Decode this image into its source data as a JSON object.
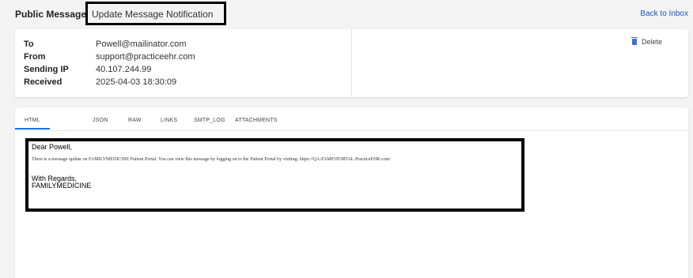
{
  "header": {
    "breadcrumb_root": "Public Message",
    "breadcrumb_separator": "›",
    "subject": "Update Message Notification",
    "back_label": "Back to Inbox"
  },
  "meta": {
    "fields": [
      {
        "label": "To",
        "value": "Powell@mailinator.com"
      },
      {
        "label": "From",
        "value": "support@practiceehr.com"
      },
      {
        "label": "Sending IP",
        "value": "40.107.244.99"
      },
      {
        "label": "Received",
        "value": "2025-04-03 18:30:09"
      }
    ],
    "delete_label": "Delete"
  },
  "tabs": [
    "HTML",
    "JSON",
    "RAW",
    "LINKS",
    "SMTP_LOG",
    "ATTACHMENTS"
  ],
  "active_tab": "HTML",
  "message": {
    "greeting": "Dear Powell,",
    "body": "There is a message update on FAMILYMEDICINE Patient Portal. You can view this message by logging on to the Patient Portal by visiting: https://QA-FAMP1PORTAL.PracticeEHR.com/",
    "closing": "With Regards,",
    "signature": "FAMILYMEDICINE"
  },
  "colors": {
    "link": "#1a56c4",
    "tab_active_underline": "#1a73e8",
    "delete_icon": "#3a6fd8"
  }
}
